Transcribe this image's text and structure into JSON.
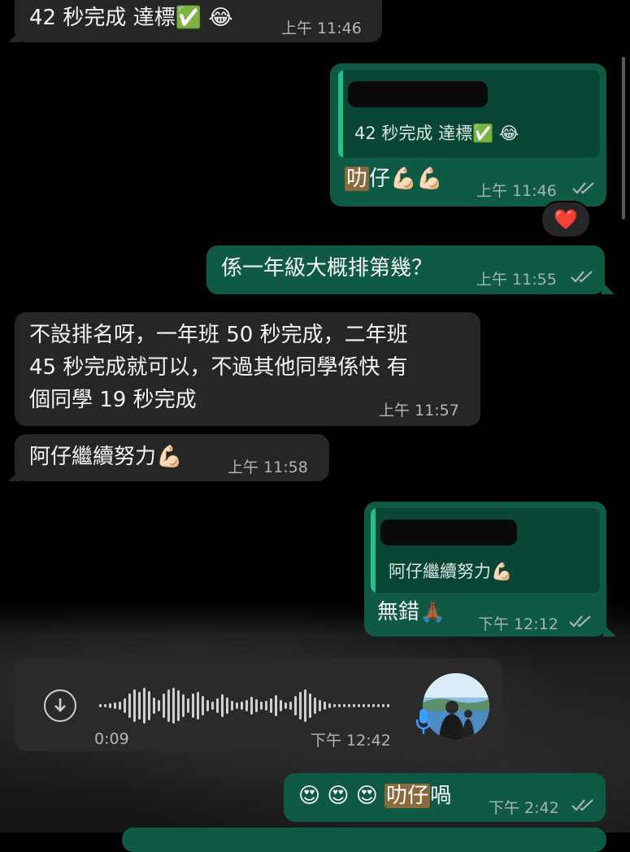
{
  "messages": [
    {
      "id": "m1",
      "text": "42 秒完成 達標✅ 😂",
      "time": "上午 11:46"
    },
    {
      "id": "m2",
      "quote": "42 秒完成 達標✅ 😂",
      "text_hl": "叻",
      "text_rest": "仔💪🏻💪🏻",
      "time": "上午 11:46",
      "reaction": "❤️"
    },
    {
      "id": "m3",
      "text": "係一年級大概排第幾？",
      "time": "上午 11:55"
    },
    {
      "id": "m4",
      "lines": [
        "不設排名呀，一年班 50 秒完成，二年班",
        "45 秒完成就可以，不過其他同學係快 有",
        "個同學 19 秒完成"
      ],
      "time": "上午 11:57"
    },
    {
      "id": "m5",
      "text": "阿仔繼續努力💪🏻",
      "time": "上午 11:58"
    },
    {
      "id": "m6",
      "quote": "阿仔繼續努力💪🏻",
      "text": "無錯🙏🏾",
      "time": "下午 12:12"
    },
    {
      "id": "m7",
      "duration": "0:09",
      "time": "下午 12:42"
    },
    {
      "id": "m8",
      "text_pre": "😍 😍 😍",
      "text_hl": "叻仔",
      "text_rest": "喎",
      "time": "下午 2:42"
    }
  ],
  "colors": {
    "incoming": "#262626",
    "outgoing": "#0f5a44",
    "quote": "#0a4636",
    "accent": "#25c08a"
  },
  "icons": {
    "read": "double-check-icon",
    "download": "download-icon",
    "mic": "microphone-icon"
  }
}
